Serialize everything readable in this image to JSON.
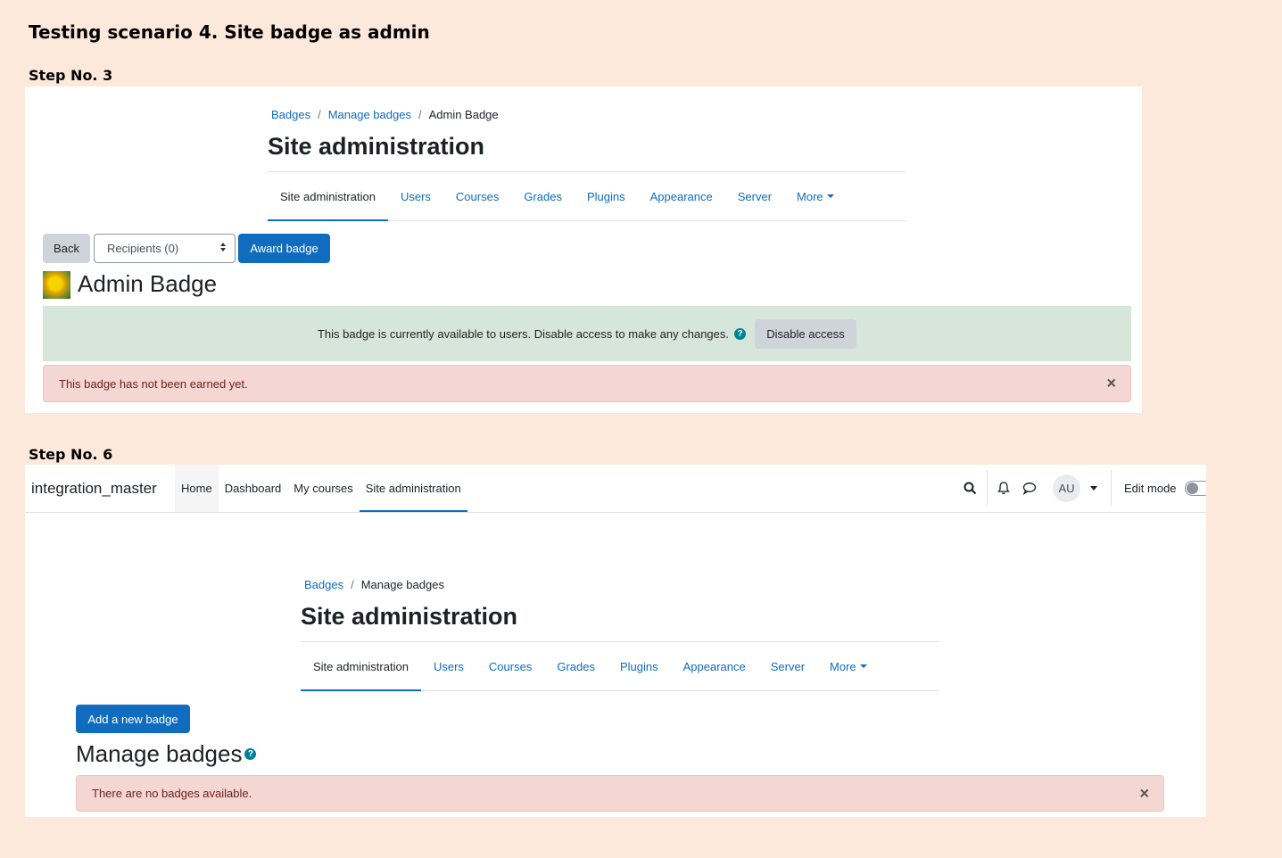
{
  "doc_title": "Testing scenario 4. Site badge as admin",
  "step3": {
    "label": "Step No. 3",
    "breadcrumb": [
      "Badges",
      "Manage badges",
      "Admin Badge"
    ],
    "heading": "Site administration",
    "secondary_nav": [
      {
        "label": "Site administration",
        "active": true
      },
      {
        "label": "Users"
      },
      {
        "label": "Courses"
      },
      {
        "label": "Grades"
      },
      {
        "label": "Plugins"
      },
      {
        "label": "Appearance"
      },
      {
        "label": "Server"
      },
      {
        "label": "More"
      }
    ],
    "back_label": "Back",
    "recipients_value": "Recipients (0)",
    "award_label": "Award badge",
    "badge_name": "Admin Badge",
    "availability_text": "This badge is currently available to users. Disable access to make any changes.",
    "help_glyph": "?",
    "disable_label": "Disable access",
    "not_earned_text": "This badge has not been earned yet.",
    "close_glyph": "×"
  },
  "step6": {
    "label": "Step No. 6",
    "site_name": "integration_master",
    "top_nav": [
      {
        "label": "Home"
      },
      {
        "label": "Dashboard"
      },
      {
        "label": "My courses"
      },
      {
        "label": "Site administration",
        "active": true
      }
    ],
    "avatar_initials": "AU",
    "edit_mode_label": "Edit mode",
    "breadcrumb": [
      "Badges",
      "Manage badges"
    ],
    "heading": "Site administration",
    "secondary_nav": [
      {
        "label": "Site administration",
        "active": true
      },
      {
        "label": "Users"
      },
      {
        "label": "Courses"
      },
      {
        "label": "Grades"
      },
      {
        "label": "Plugins"
      },
      {
        "label": "Appearance"
      },
      {
        "label": "Server"
      },
      {
        "label": "More"
      }
    ],
    "add_badge_label": "Add a new badge",
    "manage_title": "Manage badges",
    "help_glyph": "?",
    "no_badges_text": "There are no badges available.",
    "close_glyph": "×"
  },
  "icons": {
    "search": "search-icon",
    "bell": "bell-icon",
    "message": "message-icon",
    "close": "close-icon",
    "help": "help-icon"
  },
  "colors": {
    "background": "#fde9db",
    "primary": "#0f6cbf",
    "success_bg": "#d7e6da",
    "danger_bg": "#f4d6d2",
    "help": "#008196"
  }
}
